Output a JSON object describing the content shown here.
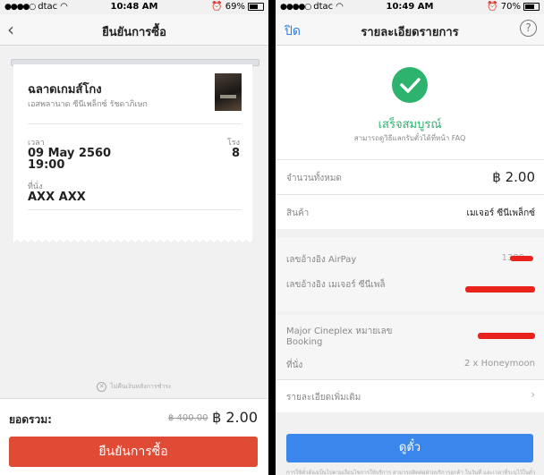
{
  "left": {
    "status": {
      "carrier": "dtac",
      "time": "10:48 AM",
      "battery": "69%"
    },
    "nav": {
      "title": "ยืนยันการซื้อ"
    },
    "ticket": {
      "movie_title": "ฉลาดเกมส์โกง",
      "cinema": "เอสพลานาด ซีนีเพล็กซ์ รัชดาภิเษก",
      "time_label": "เวลา",
      "date": "09 May 2560",
      "time": "19:00",
      "theater_label": "โรง",
      "theater": "8",
      "seat_label": "ที่นั่ง",
      "seat": "AXX AXX"
    },
    "no_refund_note": "ไม่คืนเงินหลังการชำระ",
    "total_label": "ยอดรวม:",
    "old_price": "฿ 400.00",
    "new_price": "฿ 2.00",
    "confirm_button": "ยืนยันการซื้อ"
  },
  "right": {
    "status": {
      "carrier": "dtac",
      "time": "10:49 AM",
      "battery": "70%"
    },
    "nav": {
      "close": "ปิด",
      "title": "รายละเอียดรายการ",
      "help": "?"
    },
    "success_title": "เสร็จสมบูรณ์",
    "success_sub": "สามารถดูวิธีแลกรับตั๋วได้ที่หน้า FAQ",
    "amount_label": "จำนวนทั้งหมด",
    "amount_value": "฿ 2.00",
    "product_label": "สินค้า",
    "product_value": "เมเจอร์ ซีนีเพล็กซ์",
    "airpay_ref_label": "เลขอ้างอิง AirPay",
    "airpay_ref_value": "1389",
    "major_ref_label": "เลขอ้างอิง เมเจอร์ ซีนีเพล็",
    "booking_label_1": "Major Cineplex หมายเลข",
    "booking_label_2": "Booking",
    "seat_label": "ที่นั่ง",
    "seat_value": "2 x Honeymoon",
    "more_details": "รายละเอียดเพิ่มเติม",
    "view_button": "ดูตั๋ว",
    "footnote": "การใช้ตั๋วต้องเป็นไปตามเงื่อนไขการให้บริการ สามารถติดต่อฝ่ายบริการลูกค้า ในวันที่ และเวลาที่ระบุไว้ในตั๋ว"
  },
  "colors": {
    "accent_red": "#e04b36",
    "accent_blue": "#3a86ec",
    "success_green": "#2db36e",
    "redaction": "#e8231c"
  }
}
